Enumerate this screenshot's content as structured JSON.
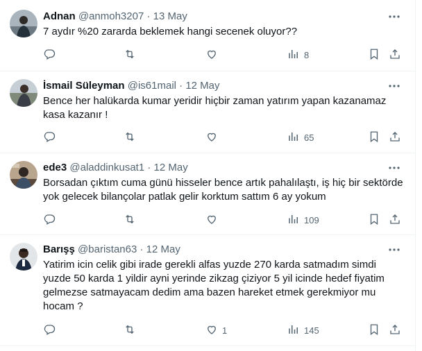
{
  "tweets": [
    {
      "name": "Adnan",
      "handle": "@anmoh3207",
      "date": "· 13 May",
      "text": "7 aydır %20 zararda beklemek hangi secenek oluyor??",
      "likes": "",
      "views": "8"
    },
    {
      "name": "İsmail Süleyman",
      "handle": "@is61mail",
      "date": "· 12 May",
      "text": "Bence her halükarda kumar yeridir hiçbir zaman yatırım yapan kazanamaz kasa kazanır !",
      "likes": "",
      "views": "65"
    },
    {
      "name": "ede3",
      "handle": "@aladdinkusat1",
      "date": "· 12 May",
      "text": "Borsadan çıktım cuma günü hisseler bence artık pahalılaştı, iş hiç bir sektörde yok gelecek bilançolar patlak gelir korktum sattım 6 ay yokum",
      "likes": "",
      "views": "109"
    },
    {
      "name": "Barışş",
      "handle": "@baristan63",
      "date": "· 12 May",
      "text": "Yatirim icin celik gibi irade gerekli alfas yuzde 270 karda satmadım simdi yuzde 50 karda 1 yildir ayni yerinde zikzag çiziyor  5 yil icinde hedef fiyatim gelmezse satmayacam dedim ama bazen hareket etmek gerekmiyor mu hocam ?",
      "likes": "1",
      "views": "145"
    }
  ],
  "icons": {
    "reply": "reply-icon",
    "retweet": "retweet-icon",
    "like": "like-icon",
    "views": "views-icon",
    "bookmark": "bookmark-icon",
    "share": "share-icon",
    "more": "more-icon"
  },
  "colors": {
    "text": "#0f1419",
    "muted": "#536471",
    "border": "#eff3f4"
  }
}
